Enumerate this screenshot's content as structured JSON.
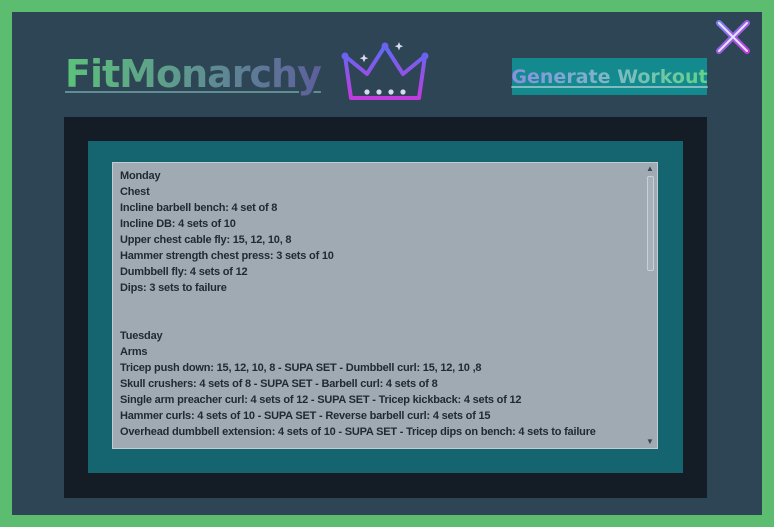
{
  "app": {
    "logo_text": "FitMonarchy",
    "generate_label": "Generate Workout"
  },
  "icons": {
    "crown": "crown-icon",
    "close": "close-icon"
  },
  "colors": {
    "border": "#5cbd70",
    "background": "#2e4556",
    "outer_panel": "#141d26",
    "inner_panel": "#156570",
    "button": "#128a8e",
    "textarea": "#9faab3"
  },
  "workout": {
    "lines": [
      "Monday",
      "Chest",
      "Incline barbell bench: 4 set of 8",
      "Incline DB: 4 sets of 10",
      "Upper chest cable fly: 15, 12, 10, 8",
      "Hammer strength chest press: 3 sets of 10",
      "Dumbbell fly: 4 sets of 12",
      "Dips: 3 sets to failure",
      "",
      "",
      "Tuesday",
      "Arms",
      "Tricep push down: 15, 12, 10, 8 - SUPA SET - Dumbbell curl: 15, 12, 10 ,8",
      "Skull crushers: 4 sets of 8 - SUPA SET - Barbell curl: 4 sets of 8",
      "Single arm preacher curl: 4 sets of 12 - SUPA SET - Tricep kickback: 4 sets of 12",
      "Hammer curls: 4 sets of 10 - SUPA SET - Reverse barbell curl: 4 sets of 15",
      "Overhead dumbbell extension: 4 sets of 10 - SUPA SET - Tricep dips on bench: 4 sets to failure"
    ]
  }
}
